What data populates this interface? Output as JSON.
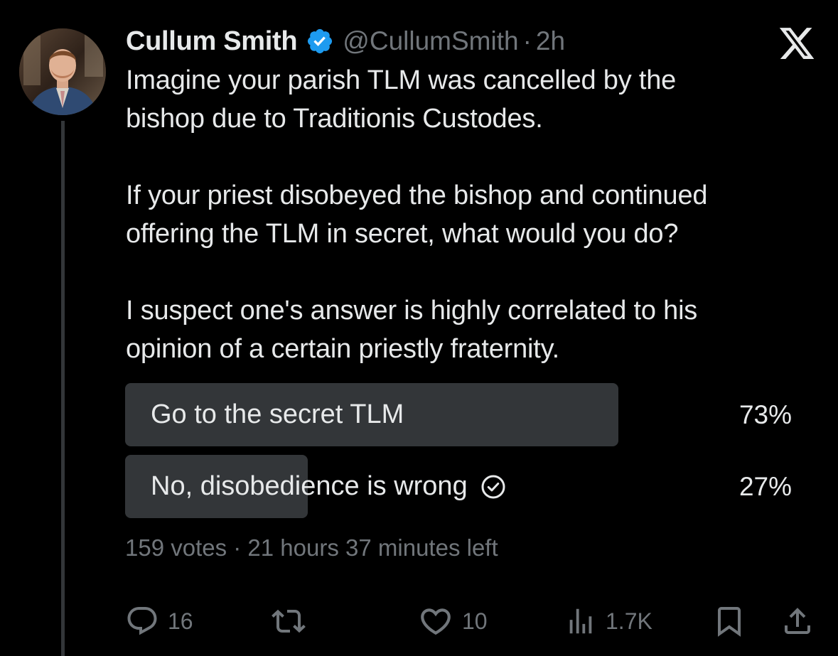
{
  "tweet": {
    "display_name": "Cullum Smith",
    "handle": "@CullumSmith",
    "separator": "·",
    "time": "2h",
    "text_lines": [
      "Imagine your parish TLM was cancelled by the",
      "bishop due to Traditionis Custodes.",
      "If your priest disobeyed the bishop and continued",
      "offering the TLM in secret, what would you do?",
      "I suspect one's answer is highly correlated to his",
      "opinion of a certain priestly fraternity."
    ]
  },
  "poll": {
    "options": [
      {
        "label": "Go to the secret TLM",
        "percent_text": "73%",
        "share": 0.73,
        "selected": false
      },
      {
        "label": "No, disobedience is wrong",
        "percent_text": "27%",
        "share": 0.27,
        "selected": true
      }
    ],
    "meta": "159 votes · 21 hours 37 minutes left"
  },
  "actions": {
    "replies": "16",
    "reposts": "",
    "likes": "10",
    "views": "1.7K"
  },
  "icons": {
    "verified": "verified-badge-icon",
    "logo": "x-logo-icon",
    "reply": "reply-icon",
    "repost": "repost-icon",
    "like": "heart-icon",
    "views": "views-icon",
    "bookmark": "bookmark-icon",
    "share": "share-icon",
    "poll_selected": "check-circle-icon"
  },
  "colors": {
    "background": "#000000",
    "text": "#e7e9ea",
    "muted": "#71767b",
    "poll_bar": "#333639",
    "verified_blue": "#1d9bf0"
  }
}
